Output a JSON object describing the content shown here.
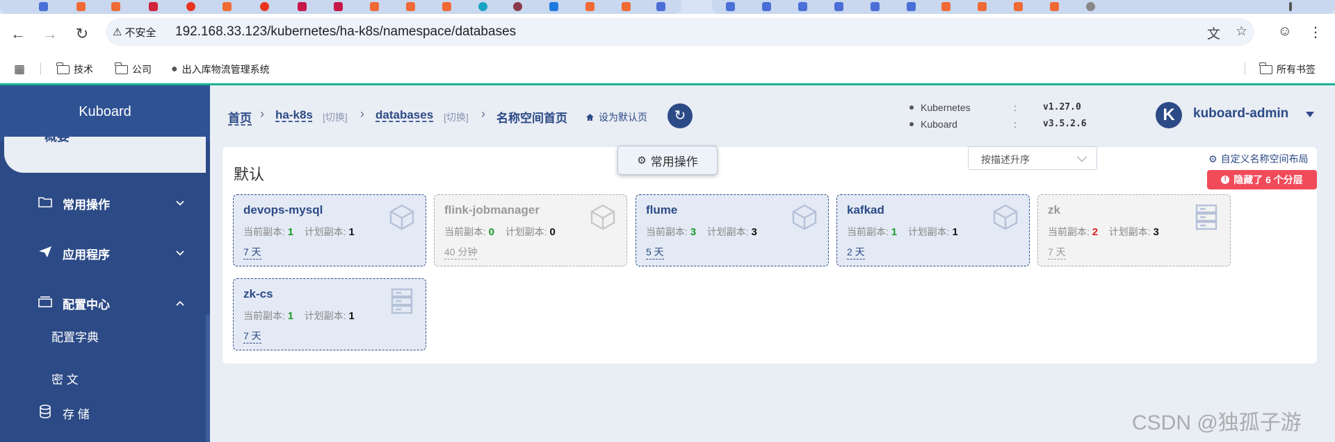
{
  "browser": {
    "security_label": "不安全",
    "url": "192.168.33.123/kubernetes/ha-k8s/namespace/databases",
    "bookmarks": [
      {
        "label": "技术",
        "icon": "folder-icon"
      },
      {
        "label": "公司",
        "icon": "folder-icon"
      },
      {
        "label": "出入库物流管理系统",
        "icon": "globe-icon"
      }
    ],
    "all_bookmarks_label": "所有书签"
  },
  "sidebar": {
    "title": "Kuboard",
    "cut_item_label": "概要",
    "items": [
      {
        "label": "常用操作",
        "icon": "folder-icon",
        "expanded": false
      },
      {
        "label": "应用程序",
        "icon": "send-icon",
        "expanded": false
      },
      {
        "label": "配置中心",
        "icon": "config-icon",
        "expanded": true
      }
    ],
    "sub_items": [
      "配置字典",
      "密 文"
    ],
    "storage_label": "存 储"
  },
  "header": {
    "breadcrumbs": {
      "home": "首页",
      "cluster": "ha-k8s",
      "cluster_switch": "[切换]",
      "namespace": "databases",
      "namespace_switch": "[切换]",
      "current": "名称空间首页"
    },
    "set_default_label": "设为默认页",
    "versions": [
      {
        "name": "Kubernetes",
        "value": "v1.27.0"
      },
      {
        "name": "Kuboard",
        "value": "v3.5.2.6"
      }
    ],
    "avatar_letter": "K",
    "user": "kuboard-admin"
  },
  "content": {
    "group_title": "默认",
    "common_ops_label": "常用操作",
    "sort_label": "按描述升序",
    "custom_layout_label": "自定义名称空间布局",
    "hidden_layers_label": "隐藏了 6 个分层",
    "current_replicas_label": "当前副本:",
    "planned_replicas_label": "计划副本:",
    "workloads": [
      {
        "name": "devops-mysql",
        "current": "1",
        "planned": "1",
        "age": "7 天",
        "active": true,
        "icon": "deployment-cube-icon"
      },
      {
        "name": "flink-jobmanager",
        "current": "0",
        "planned": "0",
        "age": "40 分钟",
        "active": false,
        "icon": "deployment-cube-icon"
      },
      {
        "name": "flume",
        "current": "3",
        "planned": "3",
        "age": "5 天",
        "active": true,
        "icon": "deployment-cube-icon"
      },
      {
        "name": "kafkad",
        "current": "1",
        "planned": "1",
        "age": "2 天",
        "active": true,
        "icon": "deployment-cube-icon"
      },
      {
        "name": "zk",
        "current": "2",
        "planned": "3",
        "age": "7 天",
        "active": false,
        "icon": "statefulset-server-icon"
      },
      {
        "name": "zk-cs",
        "current": "1",
        "planned": "1",
        "age": "7 天",
        "active": true,
        "icon": "statefulset-server-icon"
      }
    ]
  },
  "watermark": "CSDN @独孤子游",
  "colors": {
    "primary": "#2c4a86",
    "accent": "#19b394",
    "danger": "#f14b5a",
    "replica_ok": "#1a9a2a",
    "replica_warn": "#e02020"
  }
}
